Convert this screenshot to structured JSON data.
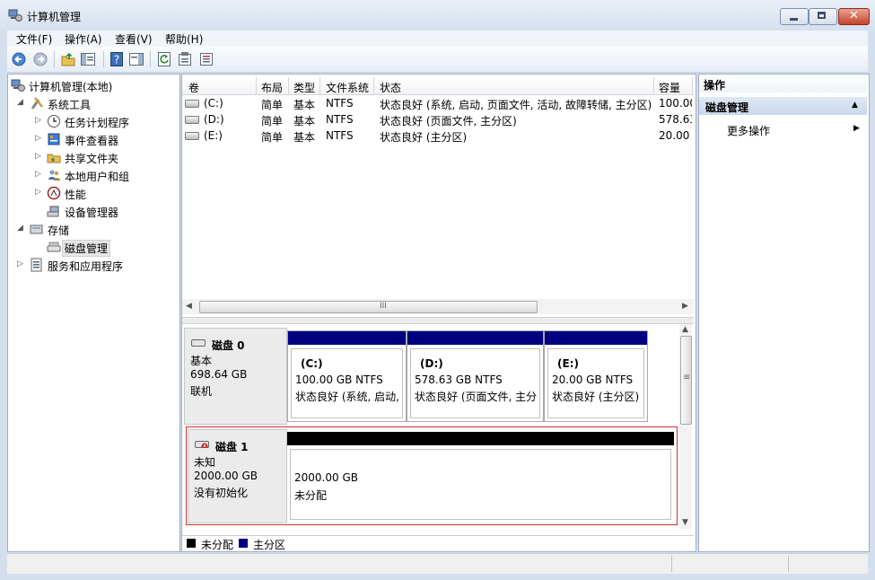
{
  "window": {
    "title": "计算机管理"
  },
  "menu": [
    "文件(F)",
    "操作(A)",
    "查看(V)",
    "帮助(H)"
  ],
  "toolbar": [
    {
      "name": "back-icon"
    },
    {
      "name": "forward-icon"
    },
    {
      "name": "up-folder-icon"
    },
    {
      "name": "show-hide-console-tree-icon"
    },
    {
      "name": "help-icon"
    },
    {
      "name": "show-hide-action-pane-icon"
    },
    {
      "name": "refresh-icon"
    },
    {
      "name": "properties-icon"
    },
    {
      "name": "export-list-icon"
    }
  ],
  "tree": [
    {
      "label": "计算机管理(本地)",
      "level": 0,
      "expander": "",
      "icon": "computer-management-icon"
    },
    {
      "label": "系统工具",
      "level": 1,
      "expander": "open",
      "icon": "system-tools-icon"
    },
    {
      "label": "任务计划程序",
      "level": 2,
      "expander": "closed",
      "icon": "task-scheduler-icon"
    },
    {
      "label": "事件查看器",
      "level": 2,
      "expander": "closed",
      "icon": "event-viewer-icon"
    },
    {
      "label": "共享文件夹",
      "level": 2,
      "expander": "closed",
      "icon": "shared-folders-icon"
    },
    {
      "label": "本地用户和组",
      "level": 2,
      "expander": "closed",
      "icon": "local-users-groups-icon"
    },
    {
      "label": "性能",
      "level": 2,
      "expander": "closed",
      "icon": "performance-icon"
    },
    {
      "label": "设备管理器",
      "level": 2,
      "expander": "",
      "icon": "device-manager-icon"
    },
    {
      "label": "存储",
      "level": 1,
      "expander": "open",
      "icon": "storage-icon"
    },
    {
      "label": "磁盘管理",
      "level": 2,
      "expander": "",
      "icon": "disk-management-icon",
      "selected": true
    },
    {
      "label": "服务和应用程序",
      "level": 1,
      "expander": "closed",
      "icon": "services-applications-icon"
    }
  ],
  "volumes": {
    "columns": [
      "卷",
      "布局",
      "类型",
      "文件系统",
      "状态",
      "容量"
    ],
    "rows": [
      [
        "(C:)",
        "简单",
        "基本",
        "NTFS",
        "状态良好 (系统, 启动, 页面文件, 活动, 故障转储, 主分区)",
        "100.00"
      ],
      [
        "(D:)",
        "简单",
        "基本",
        "NTFS",
        "状态良好 (页面文件, 主分区)",
        "578.63"
      ],
      [
        "(E:)",
        "简单",
        "基本",
        "NTFS",
        "状态良好 (主分区)",
        "20.00 ("
      ]
    ],
    "scroll_grip": "III"
  },
  "disks": [
    {
      "name": "磁盘 0",
      "type": "基本",
      "size": "698.64 GB",
      "status": "联机",
      "partitions": [
        {
          "letter": "(C:)",
          "size": "100.00 GB NTFS",
          "status": "状态良好 (系统, 启动,",
          "kind": "primary"
        },
        {
          "letter": "(D:)",
          "size": "578.63 GB NTFS",
          "status": "状态良好 (页面文件, 主分",
          "kind": "primary"
        },
        {
          "letter": "(E:)",
          "size": "20.00 GB NTFS",
          "status": "状态良好 (主分区)",
          "kind": "primary"
        }
      ]
    },
    {
      "name": "磁盘 1",
      "type": "未知",
      "size": "2000.00 GB",
      "status": "没有初始化",
      "partitions": [
        {
          "letter": "",
          "size": "2000.00 GB",
          "status": "未分配",
          "kind": "unallocated"
        }
      ]
    }
  ],
  "disk_scroll_grip": "≡",
  "legend": [
    {
      "label": "未分配",
      "color": "#000000"
    },
    {
      "label": "主分区",
      "color": "#000080"
    }
  ],
  "actions": {
    "header": "操作",
    "section": "磁盘管理",
    "items": [
      "更多操作"
    ]
  },
  "colors": {
    "primary": "#000080",
    "unallocated": "#000000",
    "selected_border": "#d03030"
  }
}
